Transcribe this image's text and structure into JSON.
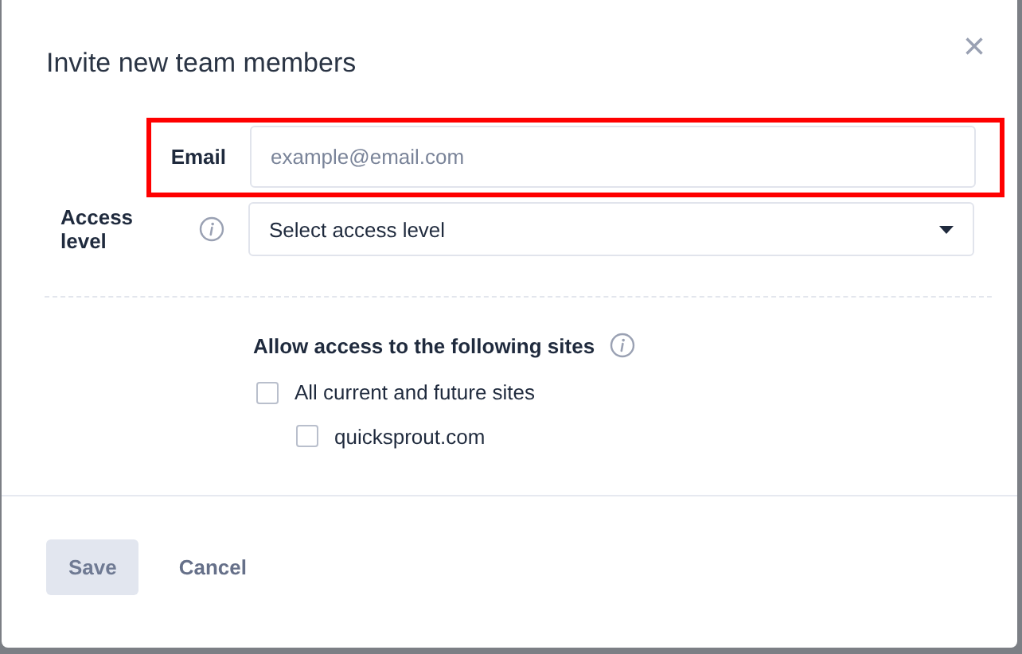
{
  "dialog": {
    "title": "Invite new team members",
    "close": "×"
  },
  "email": {
    "label": "Email",
    "placeholder": "example@email.com",
    "highlighted": true
  },
  "access_level": {
    "label": "Access level",
    "value": "Select access level"
  },
  "sites": {
    "heading": "Allow access to the following sites",
    "options": [
      {
        "label": "All current and future sites",
        "checked": false,
        "children": [
          {
            "label": "quicksprout.com",
            "checked": false
          }
        ]
      }
    ]
  },
  "buttons": [
    {
      "label": "Save",
      "kind": "primary",
      "disabled": true
    },
    {
      "label": "Cancel",
      "kind": "link",
      "disabled": false
    }
  ]
}
